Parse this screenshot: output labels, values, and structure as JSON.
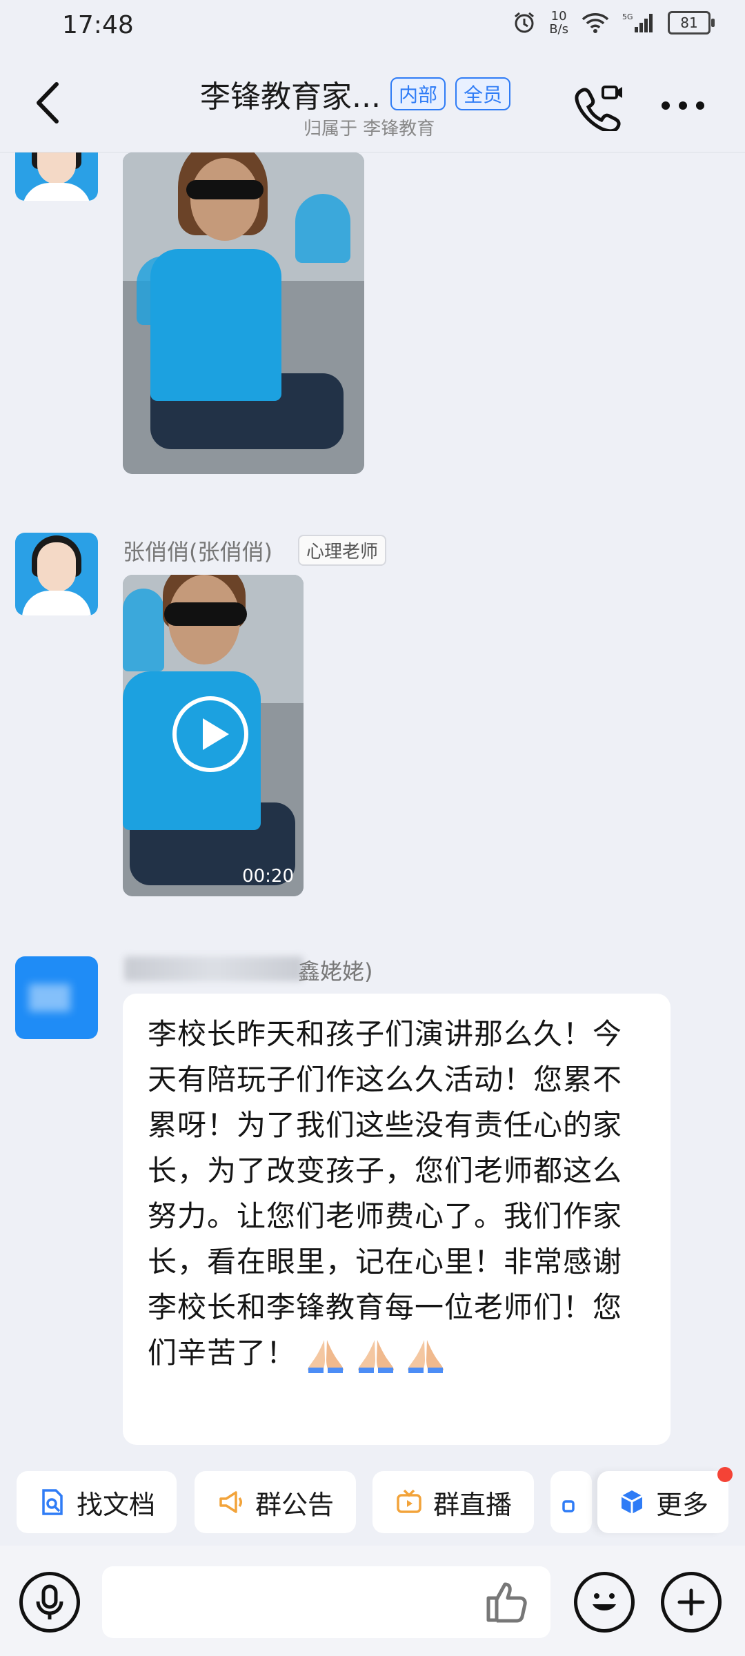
{
  "status_bar": {
    "time": "17:48",
    "speed_value": "10",
    "speed_unit": "B/s",
    "battery": "81"
  },
  "header": {
    "title": "李锋教育家...",
    "tags": [
      "内部",
      "全员"
    ],
    "subtitle": "归属于 李锋教育"
  },
  "messages": [
    {
      "sender": "张俏俏(张俏俏)",
      "role": "心理老师",
      "video_duration": "00:20"
    },
    {
      "sender_visible": "鑫姥姥)",
      "text": "李校长昨天和孩子们演讲那么久！今天有陪玩子们作这么久活动！您累不累呀！为了我们这些没有责任心的家长，为了改变孩子，您们老师都这么努力。让您们老师费心了。我们作家长，看在眼里，记在心里！非常感谢李校长和李锋教育每一位老师们！您们辛苦了！"
    }
  ],
  "quick_actions": [
    {
      "label": "找文档",
      "icon": "doc-search-icon"
    },
    {
      "label": "群公告",
      "icon": "megaphone-icon"
    },
    {
      "label": "群直播",
      "icon": "live-tv-icon"
    },
    {
      "label": "更多",
      "icon": "cube-icon"
    }
  ],
  "colors": {
    "accent": "#2f7cf6",
    "background": "#eef0f6",
    "badge": "#f44336"
  }
}
